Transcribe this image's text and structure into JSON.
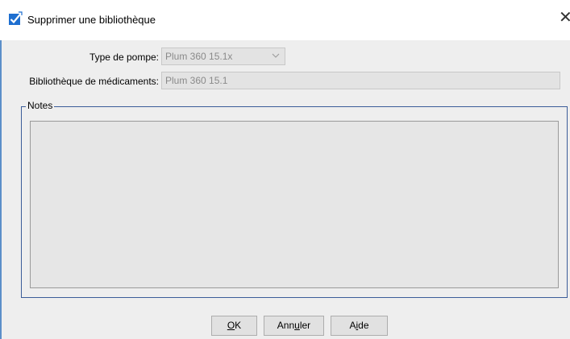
{
  "window": {
    "title": "Supprimer une bibliothèque",
    "icon": "checkmark-icon",
    "close_glyph": "✕"
  },
  "form": {
    "pump_type_label": "Type de pompe:",
    "pump_type_value": "Plum 360 15.1x",
    "library_label": "Bibliothèque de médicaments:",
    "library_value": "Plum 360 15.1"
  },
  "notes": {
    "legend": "Notes",
    "value": ""
  },
  "buttons": {
    "ok": {
      "pre": "",
      "mn": "O",
      "post": "K"
    },
    "cancel": {
      "pre": "Ann",
      "mn": "u",
      "post": "ler"
    },
    "help": {
      "pre": "A",
      "mn": "i",
      "post": "de"
    }
  },
  "colors": {
    "accent_blue": "#3b5c99",
    "window_bg": "#eeeeee",
    "check_icon": "#1e6fd0"
  }
}
